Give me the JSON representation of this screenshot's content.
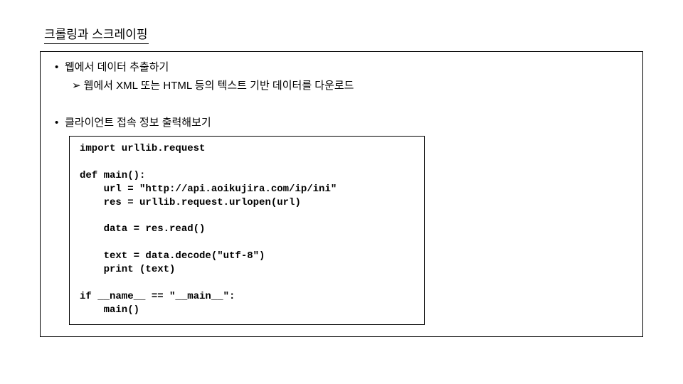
{
  "title": "크롤링과 스크레이핑",
  "section1": {
    "bullet": "웹에서 데이터 추출하기",
    "sub": "웹에서 XML 또는 HTML 등의 텍스트 기반 데이터를 다운로드"
  },
  "section2": {
    "bullet": "클라이언트 접속 정보 출력해보기"
  },
  "code": "import urllib.request\n\ndef main():\n    url = \"http://api.aoikujira.com/ip/ini\"\n    res = urllib.request.urlopen(url)\n\n    data = res.read()\n\n    text = data.decode(\"utf-8\")\n    print (text)\n\nif __name__ == \"__main__\":\n    main()"
}
